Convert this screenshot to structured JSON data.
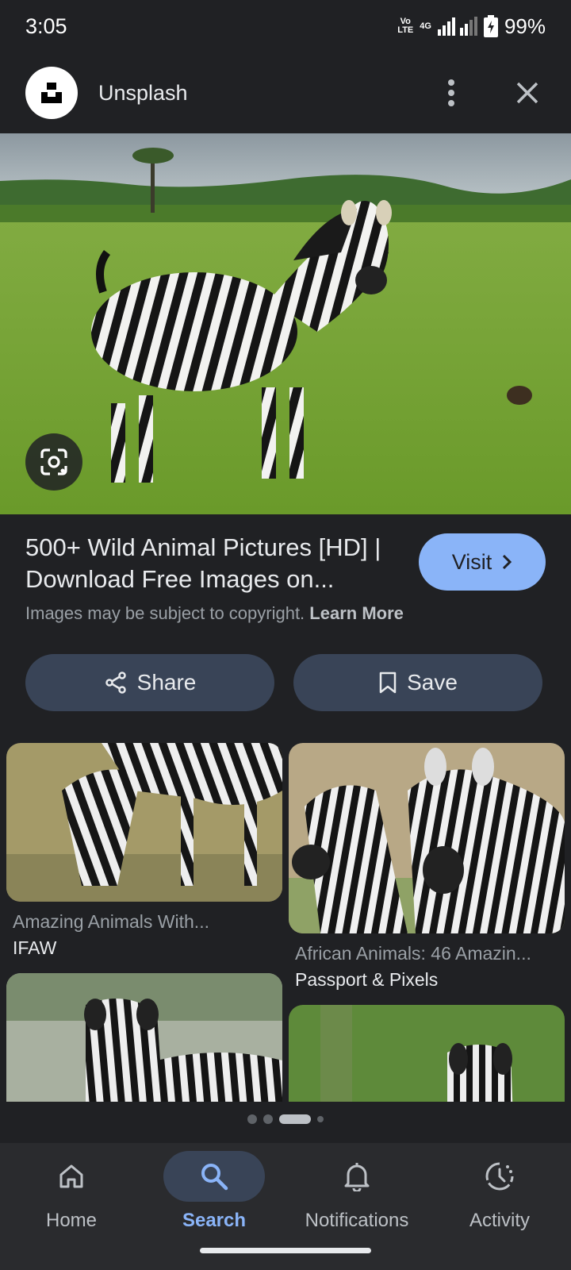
{
  "status_bar": {
    "time": "3:05",
    "network_top": "VoLTE",
    "network_label": "4G",
    "battery": "99%"
  },
  "header": {
    "site_name": "Unsplash"
  },
  "result": {
    "title": "500+ Wild Animal Pictures [HD] | Download Free Images on...",
    "visit_label": "Visit",
    "copyright_text": "Images may be subject to copyright.",
    "learn_more": "Learn More"
  },
  "actions": {
    "share_label": "Share",
    "save_label": "Save"
  },
  "related": [
    {
      "title": "Amazing Animals With...",
      "source": "IFAW"
    },
    {
      "title": "African Animals: 46 Amazin...",
      "source": "Passport & Pixels"
    },
    {
      "title": "",
      "source": ""
    },
    {
      "title": "",
      "source": ""
    }
  ],
  "nav": [
    {
      "label": "Home",
      "icon": "home-icon"
    },
    {
      "label": "Search",
      "icon": "search-icon"
    },
    {
      "label": "Notifications",
      "icon": "bell-icon"
    },
    {
      "label": "Activity",
      "icon": "activity-icon"
    }
  ],
  "colors": {
    "accent": "#8ab4f8",
    "pill": "#394457",
    "background": "#202124"
  }
}
